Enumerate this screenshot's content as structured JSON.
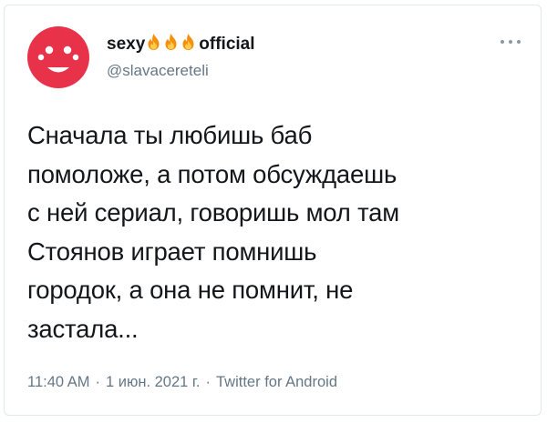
{
  "colors": {
    "avatar_bg": "#e8324a",
    "avatar_face": "#ffffff",
    "text_primary": "#14171a",
    "text_secondary": "#657786",
    "flame_orange": "#f4900c",
    "flame_yellow": "#ffcc4d"
  },
  "user": {
    "display_name_prefix": "sexy",
    "display_name_emoji": [
      "fire",
      "fire",
      "fire"
    ],
    "display_name_suffix": "official",
    "handle": "@slavacereteli",
    "avatar_icon": "smiley-face-icon"
  },
  "menu": {
    "icon": "more-dots-icon"
  },
  "tweet": {
    "lines": [
      "Сначала ты любишь баб",
      "помоложе, а потом обсуждаешь",
      "с ней сериал, говоришь мол там",
      "Стоянов играет помнишь",
      "городок, а она не помнит, не",
      "застала..."
    ]
  },
  "meta": {
    "time": "11:40 AM",
    "separator": "·",
    "date": "1 июн. 2021 г.",
    "source": "Twitter for Android"
  }
}
